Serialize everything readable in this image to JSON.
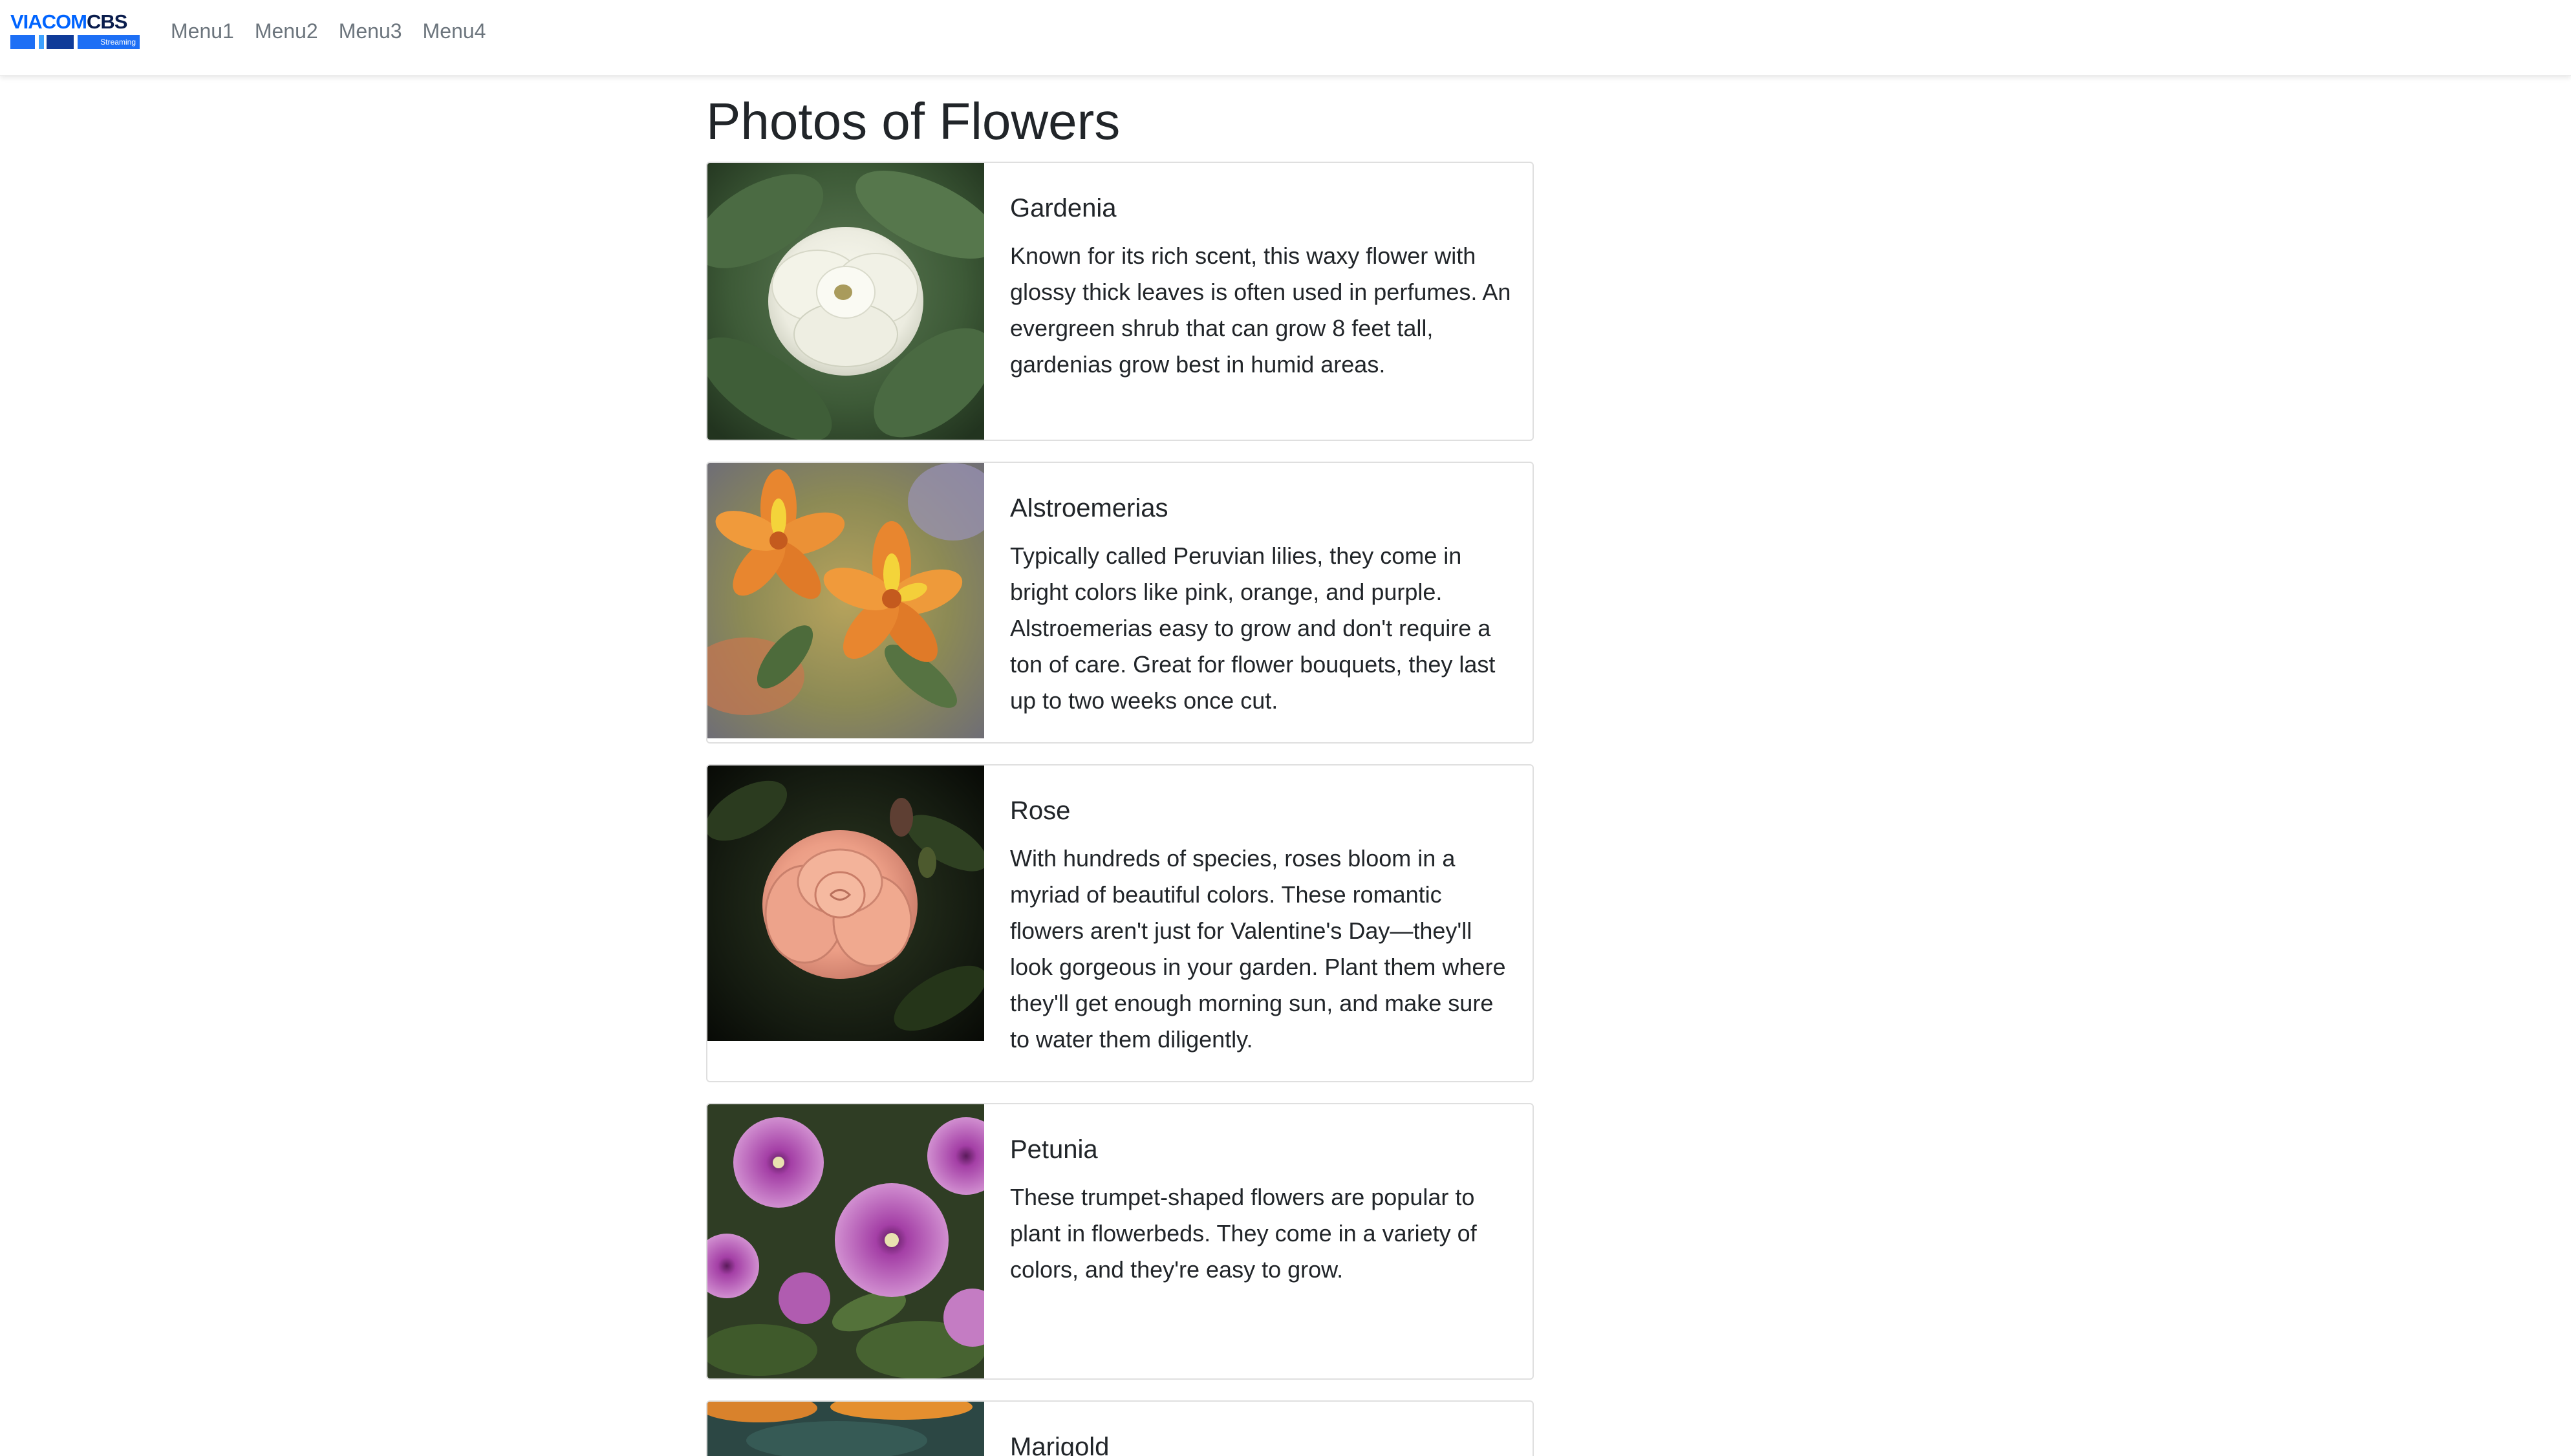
{
  "brand": {
    "logo_text_1": "VIACOM",
    "logo_text_2": "CBS",
    "logo_subtext": "Streaming",
    "colors": {
      "viacom": "#0064ff",
      "cbs": "#0a1d4d",
      "bar_dark": "#0f3b99",
      "bar_mid": "#1d6ff5",
      "bar_light": "#3da2ff"
    }
  },
  "nav": {
    "items": [
      {
        "label": "Menu1"
      },
      {
        "label": "Menu2"
      },
      {
        "label": "Menu3"
      },
      {
        "label": "Menu4"
      }
    ]
  },
  "main": {
    "title": "Photos of Flowers",
    "cards": [
      {
        "title": "Gardenia",
        "text": "Known for its rich scent, this waxy flower with glossy thick leaves is often used in perfumes. An evergreen shrub that can grow 8 feet tall, gardenias grow best in humid areas.",
        "image": "white-gardenia-flower-photo"
      },
      {
        "title": "Alstroemerias",
        "text": "Typically called Peruvian lilies, they come in bright colors like pink, orange, and purple. Alstroemerias easy to grow and don't require a ton of care. Great for flower bouquets, they last up to two weeks once cut.",
        "image": "orange-alstroemeria-flower-photo"
      },
      {
        "title": "Rose",
        "text": "With hundreds of species, roses bloom in a myriad of beautiful colors. These romantic flowers aren't just for Valentine's Day—they'll look gorgeous in your garden. Plant them where they'll get enough morning sun, and make sure to water them diligently.",
        "image": "pink-rose-flower-photo"
      },
      {
        "title": "Petunia",
        "text": "These trumpet-shaped flowers are popular to plant in flowerbeds. They come in a variety of colors, and they're easy to grow.",
        "image": "purple-petunia-flower-photo"
      },
      {
        "title": "Marigold",
        "text": "",
        "image": "orange-marigold-flower-photo"
      }
    ]
  }
}
